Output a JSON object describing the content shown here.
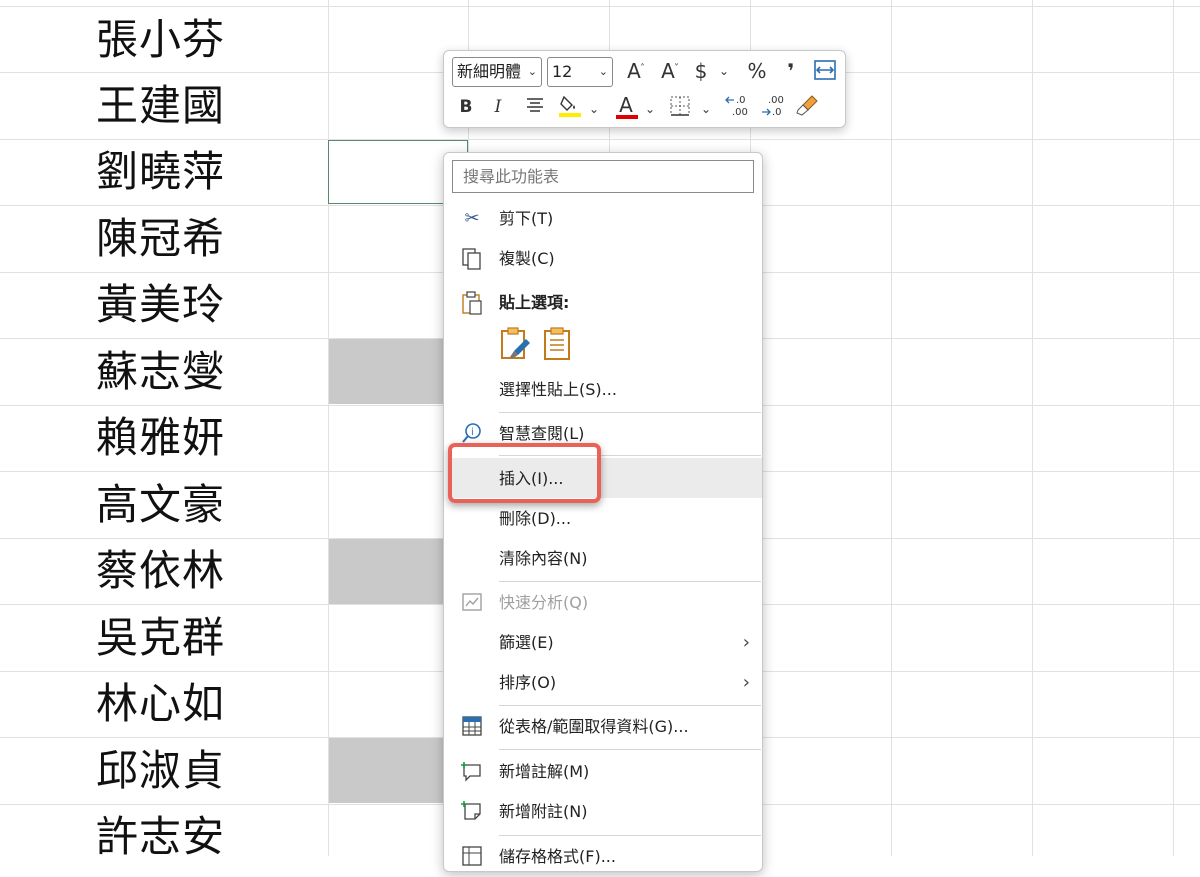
{
  "sheet": {
    "names": [
      "張小芬",
      "王建國",
      "劉曉萍",
      "陳冠希",
      "黃美玲",
      "蘇志燮",
      "賴雅妍",
      "高文豪",
      "蔡依林",
      "吳克群",
      "林心如",
      "邱淑貞",
      "許志安"
    ]
  },
  "mini_toolbar": {
    "font_name": "新細明體",
    "font_size": "12",
    "bold": "B",
    "italic": "I",
    "increase_font": "A",
    "decrease_font": "A",
    "currency": "$",
    "percent": "%",
    "comma": "❜",
    "font_color_letter": "A"
  },
  "context_menu": {
    "search_placeholder": "搜尋此功能表",
    "items": {
      "cut": "剪下(T)",
      "copy": "複製(C)",
      "paste_options": "貼上選項:",
      "paste_special": "選擇性貼上(S)...",
      "smart_lookup": "智慧查閱(L)",
      "insert": "插入(I)...",
      "delete": "刪除(D)...",
      "clear_contents": "清除內容(N)",
      "quick_analysis": "快速分析(Q)",
      "filter": "篩選(E)",
      "sort": "排序(O)",
      "get_data": "從表格/範圍取得資料(G)...",
      "new_comment": "新增註解(M)",
      "new_note": "新增附註(N)",
      "format_cells": "儲存格格式(F)..."
    }
  },
  "colors": {
    "highlight_border": "#e9625a",
    "fill_color_bar": "#ffee00",
    "font_color_bar": "#e00000"
  }
}
